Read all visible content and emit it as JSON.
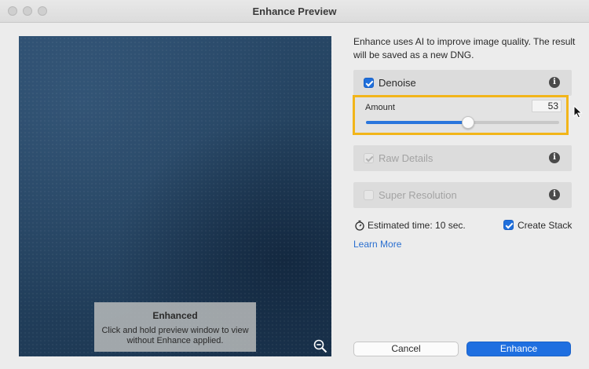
{
  "window": {
    "title": "Enhance Preview"
  },
  "preview": {
    "overlay_title": "Enhanced",
    "overlay_message": "Click and hold preview window to view without Enhance applied.",
    "zoom_icon": "zoom-out-icon"
  },
  "description": "Enhance uses AI to improve image quality. The result will be saved as a new DNG.",
  "options": {
    "denoise": {
      "label": "Denoise",
      "checked": true,
      "enabled": true,
      "info_icon": "info-icon"
    },
    "amount": {
      "label": "Amount",
      "value": "53",
      "min": 0,
      "max": 100
    },
    "raw_details": {
      "label": "Raw Details",
      "checked": true,
      "enabled": false,
      "info_icon": "info-icon"
    },
    "super_resolution": {
      "label": "Super Resolution",
      "checked": false,
      "enabled": false,
      "info_icon": "info-icon"
    }
  },
  "estimate": {
    "label": "Estimated time: 10 sec.",
    "icon": "stopwatch-icon"
  },
  "create_stack": {
    "label": "Create Stack",
    "checked": true
  },
  "learn_more": "Learn More",
  "buttons": {
    "cancel": "Cancel",
    "enhance": "Enhance"
  },
  "colors": {
    "accent": "#1f6fe0",
    "highlight": "#f2b51a"
  }
}
